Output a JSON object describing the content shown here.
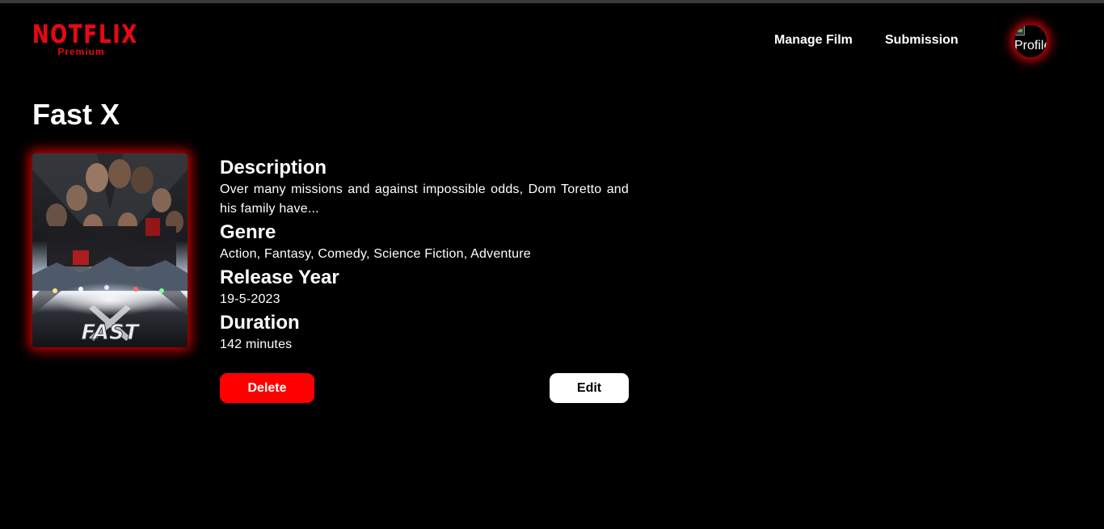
{
  "brand": {
    "logo_text": "NOTFLIX",
    "logo_subtext": "Premium",
    "accent_color": "#e50914"
  },
  "nav": {
    "items": [
      {
        "label": "Manage Film"
      },
      {
        "label": "Submission"
      }
    ],
    "profile_alt": "Profile"
  },
  "film": {
    "title": "Fast X",
    "poster_wordmark": "FAST",
    "sections": {
      "description": {
        "heading": "Description",
        "text": "Over many missions and against impossible odds, Dom Toretto and his family have..."
      },
      "genre": {
        "heading": "Genre",
        "text": "Action, Fantasy, Comedy, Science Fiction, Adventure"
      },
      "release_year": {
        "heading": "Release Year",
        "text": "19-5-2023"
      },
      "duration": {
        "heading": "Duration",
        "text": "142 minutes"
      }
    }
  },
  "actions": {
    "delete_label": "Delete",
    "edit_label": "Edit",
    "delete_color": "#ff0000"
  }
}
